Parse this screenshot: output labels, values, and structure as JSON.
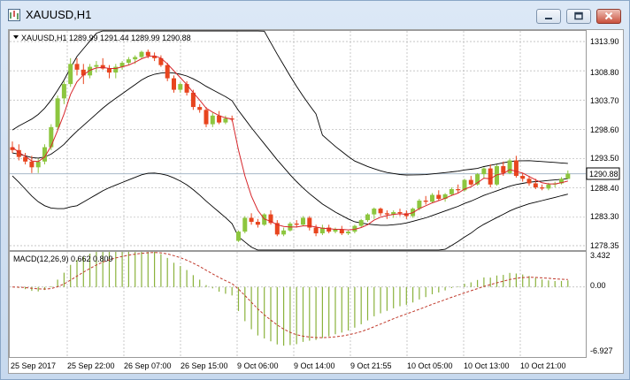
{
  "window": {
    "title": "XAUUSD,H1",
    "buttons": [
      "minimize-icon",
      "restore-icon",
      "close-icon"
    ]
  },
  "colors": {
    "bull": "#8dc63f",
    "bear": "#e8451e",
    "ma_fast": "#d7262b",
    "bands": "#000000",
    "grid": "#b4b4b4",
    "macd_hist": "#8ab23c",
    "macd_signal": "#c0392b",
    "price_line": "#a7b8c8"
  },
  "main_chart": {
    "info": "XAUUSD,H1  1289.99 1291.44 1289.99 1290.88",
    "price_labels": [
      "1313.90",
      "1308.80",
      "1303.70",
      "1298.60",
      "1293.50",
      "1288.40",
      "1283.30",
      "1278.35"
    ],
    "current_price": "1290.88",
    "ylim": [
      1278.35,
      1313.9
    ]
  },
  "macd": {
    "label": "MACD(12,26,9) 0.662 0.809",
    "axis_labels": [
      "3.432",
      "0.00",
      "-6.927"
    ],
    "ylim": [
      -6.927,
      3.432
    ]
  },
  "time_labels": [
    "25 Sep 2017",
    "25 Sep 22:00",
    "26 Sep 07:00",
    "26 Sep 15:00",
    "9 Oct 06:00",
    "9 Oct 14:00",
    "9 Oct 21:55",
    "10 Oct 05:00",
    "10 Oct 13:00",
    "10 Oct 21:00"
  ],
  "chart_data": {
    "type": "candlestick",
    "candles": [
      [
        1295.5,
        1296.5,
        1294.5,
        1295
      ],
      [
        1295,
        1296,
        1293.2,
        1293.8
      ],
      [
        1293.8,
        1294.5,
        1292.5,
        1293
      ],
      [
        1293,
        1294,
        1291,
        1292
      ],
      [
        1292,
        1293.5,
        1291,
        1293
      ],
      [
        1293,
        1296,
        1292.5,
        1295.5
      ],
      [
        1295.5,
        1299.5,
        1295,
        1299
      ],
      [
        1299,
        1304.5,
        1298.5,
        1304
      ],
      [
        1304,
        1307,
        1303,
        1306.5
      ],
      [
        1306.5,
        1311,
        1306,
        1310
      ],
      [
        1310,
        1311,
        1308,
        1309
      ],
      [
        1309,
        1310,
        1306.5,
        1308
      ],
      [
        1308,
        1310,
        1307.5,
        1309.5
      ],
      [
        1309.5,
        1310.5,
        1308.5,
        1309.8
      ],
      [
        1309.8,
        1311,
        1309,
        1309.2
      ],
      [
        1309.2,
        1309.8,
        1307.5,
        1308.5
      ],
      [
        1308.5,
        1310,
        1307.5,
        1309.5
      ],
      [
        1309.5,
        1310.5,
        1309,
        1310.2
      ],
      [
        1310.2,
        1311.2,
        1309.8,
        1310.8
      ],
      [
        1310.8,
        1311.5,
        1310,
        1311.2
      ],
      [
        1311.2,
        1312.3,
        1311,
        1312.1
      ],
      [
        1312.1,
        1312.5,
        1311,
        1311.4
      ],
      [
        1311.4,
        1312,
        1310.5,
        1311
      ],
      [
        1311,
        1311.5,
        1309.5,
        1309.8
      ],
      [
        1309.8,
        1310.2,
        1307,
        1307.5
      ],
      [
        1307.5,
        1308,
        1305,
        1305.5
      ],
      [
        1305.5,
        1306.8,
        1305,
        1306.5
      ],
      [
        1306.5,
        1307,
        1304.5,
        1305
      ],
      [
        1305,
        1305.5,
        1302,
        1302.5
      ],
      [
        1302.5,
        1303,
        1301.5,
        1302
      ],
      [
        1302,
        1302.5,
        1299,
        1299.5
      ],
      [
        1299.5,
        1301.5,
        1299,
        1301
      ],
      [
        1301,
        1301.8,
        1299.5,
        1299.8
      ],
      [
        1299.8,
        1301,
        1299.5,
        1300.5
      ],
      [
        1300.5,
        1301,
        1300,
        1300.3
      ],
      [
        1279.2,
        1281,
        1279,
        1280.8
      ],
      [
        1280.8,
        1283.5,
        1280.5,
        1283.2
      ],
      [
        1283.2,
        1284,
        1282,
        1282.5
      ],
      [
        1282.5,
        1283,
        1281.5,
        1282
      ],
      [
        1282,
        1284,
        1281.8,
        1283.8
      ],
      [
        1283.8,
        1284.5,
        1282,
        1282.3
      ],
      [
        1282.3,
        1282.8,
        1280,
        1280.3
      ],
      [
        1280.3,
        1281.5,
        1280,
        1281
      ],
      [
        1281,
        1282.5,
        1280.8,
        1282.2
      ],
      [
        1282.2,
        1282.8,
        1281.5,
        1282
      ],
      [
        1282,
        1283.5,
        1281.8,
        1283.2
      ],
      [
        1283.2,
        1283.5,
        1281,
        1281.5
      ],
      [
        1281.5,
        1282,
        1280,
        1280.5
      ],
      [
        1280.5,
        1282,
        1280.2,
        1281.5
      ],
      [
        1281.5,
        1282,
        1280.5,
        1280.8
      ],
      [
        1280.8,
        1281.5,
        1280.5,
        1281.2
      ],
      [
        1281.2,
        1281.8,
        1280.2,
        1280.5
      ],
      [
        1280.5,
        1281,
        1280.2,
        1280.8
      ],
      [
        1280.8,
        1282,
        1280.5,
        1281.8
      ],
      [
        1281.8,
        1283,
        1281.5,
        1282.8
      ],
      [
        1282.8,
        1284,
        1282.5,
        1283.8
      ],
      [
        1283.8,
        1285,
        1283,
        1284.8
      ],
      [
        1284.8,
        1285,
        1283.5,
        1284
      ],
      [
        1284,
        1284.5,
        1283,
        1283.8
      ],
      [
        1283.8,
        1284.5,
        1283.2,
        1284.2
      ],
      [
        1284.2,
        1284.8,
        1283.5,
        1284
      ],
      [
        1284,
        1284.5,
        1283,
        1283.5
      ],
      [
        1283.5,
        1285,
        1283.2,
        1284.8
      ],
      [
        1284.8,
        1286.5,
        1284.5,
        1286.2
      ],
      [
        1286.2,
        1287,
        1285.5,
        1286
      ],
      [
        1286,
        1287.5,
        1285.8,
        1287.2
      ],
      [
        1287.2,
        1288,
        1286.2,
        1286.5
      ],
      [
        1286.5,
        1287.5,
        1286,
        1287.3
      ],
      [
        1287.3,
        1288.5,
        1287,
        1288.2
      ],
      [
        1288.2,
        1289,
        1287.5,
        1288
      ],
      [
        1288,
        1290,
        1287.8,
        1289.8
      ],
      [
        1289.8,
        1290.5,
        1288.8,
        1289
      ],
      [
        1289,
        1291,
        1288.8,
        1290.8
      ],
      [
        1290.8,
        1292,
        1290,
        1291.8
      ],
      [
        1291.8,
        1292.5,
        1288.5,
        1289
      ],
      [
        1289,
        1292.5,
        1288.8,
        1292.2
      ],
      [
        1292.2,
        1293,
        1290.5,
        1291
      ],
      [
        1291,
        1293.5,
        1290.8,
        1293.2
      ],
      [
        1293.2,
        1294,
        1290.2,
        1290.5
      ],
      [
        1290.5,
        1291,
        1289.5,
        1290
      ],
      [
        1290,
        1290.5,
        1288.8,
        1289.2
      ],
      [
        1289.2,
        1290,
        1288.2,
        1288.5
      ],
      [
        1288.5,
        1289,
        1288,
        1288.3
      ],
      [
        1288.3,
        1289.3,
        1288,
        1289
      ],
      [
        1289,
        1289.5,
        1288.5,
        1289.2
      ],
      [
        1289.2,
        1290.3,
        1289,
        1290
      ],
      [
        1289.99,
        1291.44,
        1289.99,
        1290.88
      ]
    ],
    "ma_fast": [
      1295.5,
      1294.6,
      1293.9,
      1293.1,
      1293,
      1293.8,
      1295.7,
      1298.4,
      1301.3,
      1304.7,
      1306.9,
      1308.1,
      1308.9,
      1309.3,
      1309.4,
      1309.2,
      1309.2,
      1309.5,
      1309.8,
      1310.3,
      1310.9,
      1311.3,
      1311.4,
      1311,
      1310,
      1308.8,
      1307.6,
      1306.4,
      1305,
      1303.7,
      1302.3,
      1301.6,
      1301,
      1300.6,
      1300.4,
      1295,
      1290.5,
      1287,
      1284.5,
      1283,
      1282.6,
      1282,
      1281.7,
      1281.6,
      1281.6,
      1281.8,
      1281.8,
      1281.6,
      1281.4,
      1281.3,
      1281.2,
      1281.2,
      1281.1,
      1281.2,
      1281.5,
      1282,
      1282.8,
      1283.3,
      1283.6,
      1283.8,
      1283.9,
      1283.8,
      1284.1,
      1284.8,
      1285.3,
      1285.8,
      1286.2,
      1286.6,
      1287.1,
      1287.5,
      1288.2,
      1288.6,
      1289.3,
      1290.1,
      1290,
      1290.7,
      1290.9,
      1291.6,
      1291.3,
      1291,
      1290.4,
      1289.8,
      1289.3,
      1289.1,
      1289.1,
      1289.3,
      1289.6
    ],
    "bb_mid": [
      1294.5,
      1294.3,
      1294,
      1293.7,
      1293.6,
      1293.8,
      1294.3,
      1295.1,
      1296,
      1297.2,
      1298.3,
      1299.3,
      1300.3,
      1301.3,
      1302.3,
      1303.2,
      1304,
      1304.8,
      1305.6,
      1306.4,
      1307.2,
      1307.8,
      1308.2,
      1308.4,
      1308.5,
      1308.4,
      1308.2,
      1307.9,
      1307.4,
      1306.8,
      1306.1,
      1305.5,
      1304.9,
      1304.3,
      1303.6,
      1301.9,
      1300.4,
      1298.9,
      1297.5,
      1296.1,
      1294.7,
      1293.3,
      1292,
      1290.7,
      1289.5,
      1288.4,
      1287.4,
      1286.5,
      1285.6,
      1284.9,
      1284.2,
      1283.6,
      1283,
      1282.5,
      1282.3,
      1282.1,
      1282,
      1281.9,
      1281.9,
      1282,
      1282.1,
      1282.3,
      1282.6,
      1282.9,
      1283.2,
      1283.6,
      1284,
      1284.4,
      1284.8,
      1285.2,
      1285.7,
      1286.1,
      1286.6,
      1287.1,
      1287.5,
      1287.9,
      1288.3,
      1288.7,
      1289,
      1289.2,
      1289.4,
      1289.5,
      1289.6,
      1289.7,
      1289.8,
      1289.9,
      1290
    ]
  }
}
